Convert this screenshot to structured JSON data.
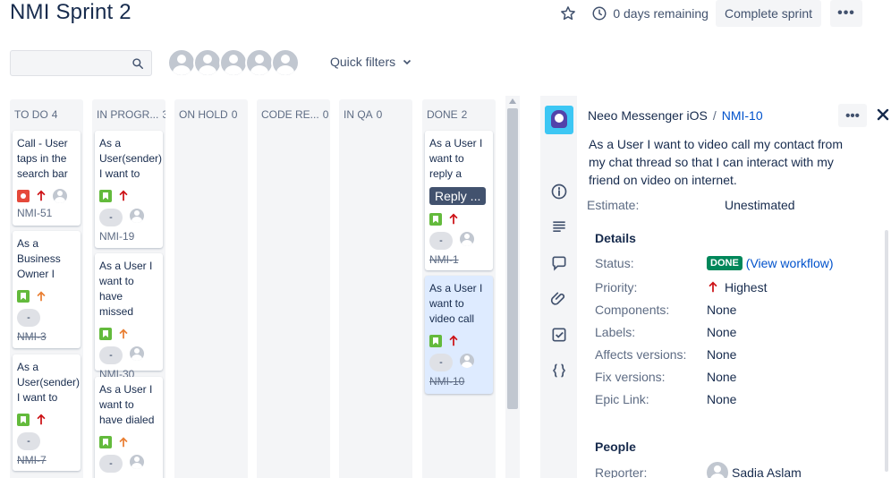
{
  "sprint": {
    "title": "NMI Sprint 2",
    "days_remaining": "0 days remaining",
    "complete_label": "Complete sprint",
    "more_label": "•••"
  },
  "filters": {
    "search_placeholder": "",
    "quick_filters_label": "Quick filters"
  },
  "columns": [
    {
      "name": "TO DO",
      "count": "4"
    },
    {
      "name": "IN PROGR...",
      "count": "3"
    },
    {
      "name": "ON HOLD",
      "count": "0"
    },
    {
      "name": "CODE RE...",
      "count": "0"
    },
    {
      "name": "IN QA",
      "count": "0"
    },
    {
      "name": "DONE",
      "count": "2"
    }
  ],
  "cards": {
    "todo": [
      {
        "summary": "Call - User taps in the search bar",
        "key": "NMI-51",
        "type": "bug",
        "priority": "highest"
      },
      {
        "summary": "As a Business Owner I",
        "estimate": "-",
        "key": "NMI-3",
        "type": "story",
        "priority": "medium"
      },
      {
        "summary": "As a User(sender) I want to",
        "estimate": "-",
        "key": "NMI-7",
        "type": "story",
        "priority": "highest"
      }
    ],
    "inprogress": [
      {
        "summary": "As a User(sender) I want to",
        "estimate": "-",
        "key": "NMI-19",
        "type": "story",
        "priority": "highest"
      },
      {
        "summary": "As a User I want to have missed",
        "estimate": "-",
        "key": "NMI-30",
        "type": "story",
        "priority": "medium"
      },
      {
        "summary": "As a User I want to have dialed",
        "estimate": "-",
        "key": "",
        "type": "story",
        "priority": "medium"
      }
    ],
    "done": [
      {
        "summary": "As a User I want to reply a",
        "chip": "Reply ...",
        "estimate": "-",
        "key": "NMI-1",
        "type": "story",
        "priority": "highest"
      },
      {
        "summary": "As a User I want to video call",
        "estimate": "-",
        "key": "NMI-10",
        "type": "story",
        "priority": "highest"
      }
    ]
  },
  "detail": {
    "project": "Neeo Messenger iOS",
    "separator": "/",
    "issue_key": "NMI-10",
    "summary": "As a User I want to video call my contact from my chat thread so that I can interact with my friend on video on internet.",
    "estimate_label": "Estimate:",
    "estimate_value": "Unestimated",
    "details_heading": "Details",
    "fields": {
      "status_label": "Status:",
      "status_value": "DONE",
      "view_workflow": "(View workflow)",
      "priority_label": "Priority:",
      "priority_value": "Highest",
      "components_label": "Components:",
      "components_value": "None",
      "labels_label": "Labels:",
      "labels_value": "None",
      "affects_label": "Affects versions:",
      "affects_value": "None",
      "fix_label": "Fix versions:",
      "fix_value": "None",
      "epic_label": "Epic Link:",
      "epic_value": "None"
    },
    "people_heading": "People",
    "reporter_label": "Reporter:",
    "reporter_value": "Sadia Aslam"
  },
  "colors": {
    "accent": "#0052cc",
    "done_green": "#00875a",
    "story_green": "#63ba3c",
    "bug_red": "#e5493a",
    "highest_red": "#cd1317",
    "medium_orange": "#e97f33",
    "selected_card": "#deebff"
  },
  "icons": [
    "star-icon",
    "clock-icon",
    "search-icon",
    "chevron-down-icon",
    "story-icon",
    "bug-icon",
    "priority-highest-icon",
    "priority-medium-icon",
    "info-icon",
    "description-icon",
    "comment-icon",
    "attachment-icon",
    "subtask-icon",
    "code-icon",
    "close-icon"
  ]
}
